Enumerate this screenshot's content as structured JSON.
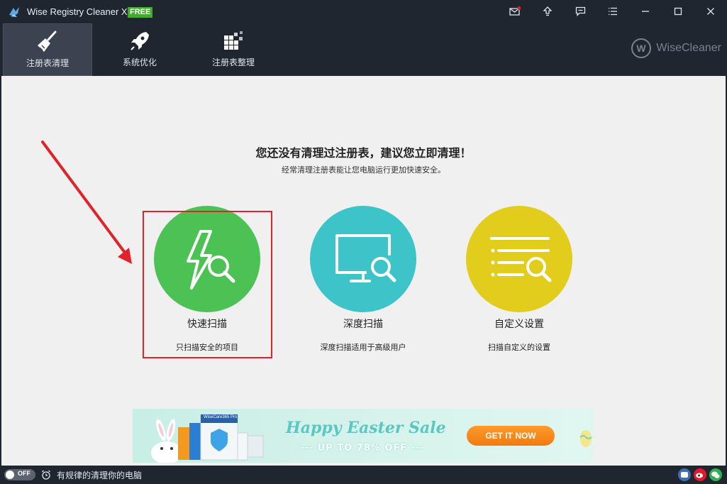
{
  "window": {
    "title": "Wise Registry Cleaner X",
    "badge": "FREE"
  },
  "toolbar": {
    "tabs": [
      {
        "label": "注册表清理",
        "icon": "broom-icon",
        "active": true
      },
      {
        "label": "系统优化",
        "icon": "rocket-icon",
        "active": false
      },
      {
        "label": "注册表整理",
        "icon": "blocks-icon",
        "active": false
      }
    ],
    "brand": "WiseCleaner"
  },
  "main": {
    "headline": "您还没有清理过注册表，建议您立即清理！",
    "subline": "经常清理注册表能让您电脑运行更加快速安全。",
    "options": [
      {
        "title": "快速扫描",
        "desc": "只扫描安全的项目",
        "color": "#4cc254",
        "icon": "lightning-search-icon"
      },
      {
        "title": "深度扫描",
        "desc": "深度扫描适用于高级用户",
        "color": "#3cc4c9",
        "icon": "monitor-search-icon"
      },
      {
        "title": "自定义设置",
        "desc": "扫描自定义的设置",
        "color": "#e2cc1c",
        "icon": "list-search-icon"
      }
    ]
  },
  "banner": {
    "title": "Happy Easter Sale",
    "subtitle": "--- UP TO 78% OFF ---",
    "button": "GET IT NOW",
    "product": "WiseCare365 Pro"
  },
  "status": {
    "toggle": "OFF",
    "schedule_text": "有规律的清理你的电脑"
  },
  "colors": {
    "titlebar": "#1f2630",
    "active_tab": "#3b4350",
    "highlight": "#e0232a"
  }
}
